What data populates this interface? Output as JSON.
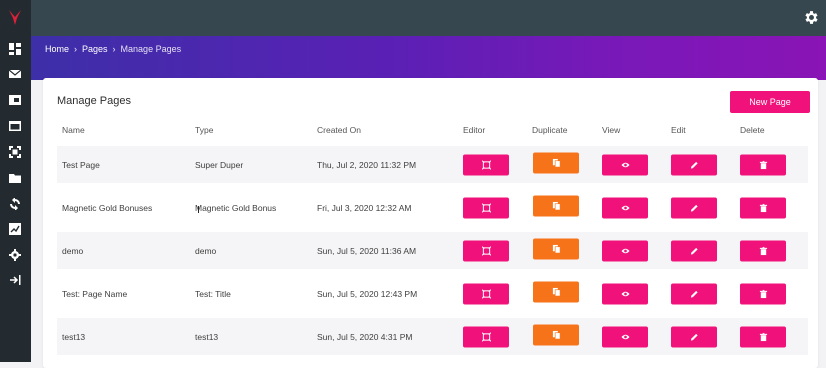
{
  "breadcrumb": {
    "home": "Home",
    "sep1": "›",
    "pages": "Pages",
    "sep2": "›",
    "current": "Manage Pages"
  },
  "page_title": "Manage Pages",
  "new_page_button": "New Page",
  "columns": [
    "Name",
    "Type",
    "Created On",
    "Editor",
    "Duplicate",
    "View",
    "Edit",
    "Delete"
  ],
  "rows": [
    {
      "name": "Test Page",
      "type": "Super Duper",
      "created": "Thu, Jul 2, 2020 11:32 PM"
    },
    {
      "name": "Magnetic Gold Bonuses",
      "type": "Magnetic Gold Bonus",
      "created": "Fri, Jul 3, 2020 12:32 AM"
    },
    {
      "name": "demo",
      "type": "demo",
      "created": "Sun, Jul 5, 2020 11:36 AM"
    },
    {
      "name": "Test: Page Name",
      "type": "Test: Title",
      "created": "Sun, Jul 5, 2020 12:43 PM"
    },
    {
      "name": "test13",
      "type": "test13",
      "created": "Sun, Jul 5, 2020 4:31 PM"
    }
  ],
  "sidebar_icons": [
    "dashboard-icon",
    "mail-icon",
    "media-icon",
    "browser-icon",
    "expand-icon",
    "folder-icon",
    "sync-icon",
    "chart-icon",
    "settings-icon",
    "logout-icon"
  ],
  "colors": {
    "accent_pink": "#f0127a",
    "accent_orange": "#f6731a",
    "sidebar": "#232b31",
    "topbar": "#37474f"
  }
}
